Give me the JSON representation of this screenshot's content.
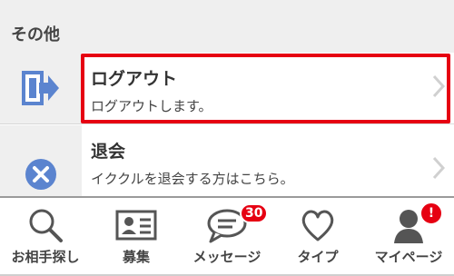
{
  "section": {
    "title": "その他"
  },
  "rows": [
    {
      "title": "ログアウト",
      "subtitle": "ログアウトします。",
      "icon": "logout-icon"
    },
    {
      "title": "退会",
      "subtitle": "イククルを退会する方はこちら。",
      "icon": "close-circle-icon"
    }
  ],
  "tabs": [
    {
      "label": "お相手探し",
      "icon": "search-icon"
    },
    {
      "label": "募集",
      "icon": "profile-card-icon"
    },
    {
      "label": "メッセージ",
      "icon": "chat-bubble-icon",
      "badge": "30"
    },
    {
      "label": "タイプ",
      "icon": "heart-icon"
    },
    {
      "label": "マイページ",
      "icon": "person-icon",
      "badge": "!"
    }
  ],
  "colors": {
    "accent_red": "#e60012",
    "icon_blue": "#5b84cf",
    "section_bg": "#efefef"
  }
}
